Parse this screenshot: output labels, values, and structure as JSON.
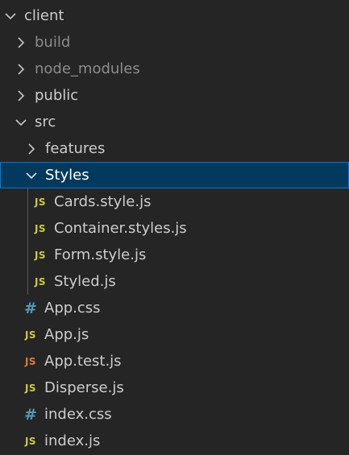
{
  "explorer": {
    "folders": {
      "client": "client",
      "build": "build",
      "node_modules": "node_modules",
      "public": "public",
      "src": "src",
      "features": "features",
      "styles": "Styles"
    },
    "files": [
      {
        "name": "Cards.style.js",
        "icon": "JS"
      },
      {
        "name": "Container.styles.js",
        "icon": "JS"
      },
      {
        "name": "Form.style.js",
        "icon": "JS"
      },
      {
        "name": "Styled.js",
        "icon": "JS"
      },
      {
        "name": "App.css",
        "icon": "#"
      },
      {
        "name": "App.js",
        "icon": "JS"
      },
      {
        "name": "App.test.js",
        "icon": "JS"
      },
      {
        "name": "Disperse.js",
        "icon": "JS"
      },
      {
        "name": "index.css",
        "icon": "#"
      },
      {
        "name": "index.js",
        "icon": "JS"
      }
    ]
  },
  "colors": {
    "background": "#252526",
    "selected_background": "#04395e",
    "selected_border": "#0078d4",
    "js_icon": "#cbcb41",
    "test_js_icon": "#e37933",
    "css_icon": "#519aba",
    "ignored_text": "#8c8c8c"
  }
}
